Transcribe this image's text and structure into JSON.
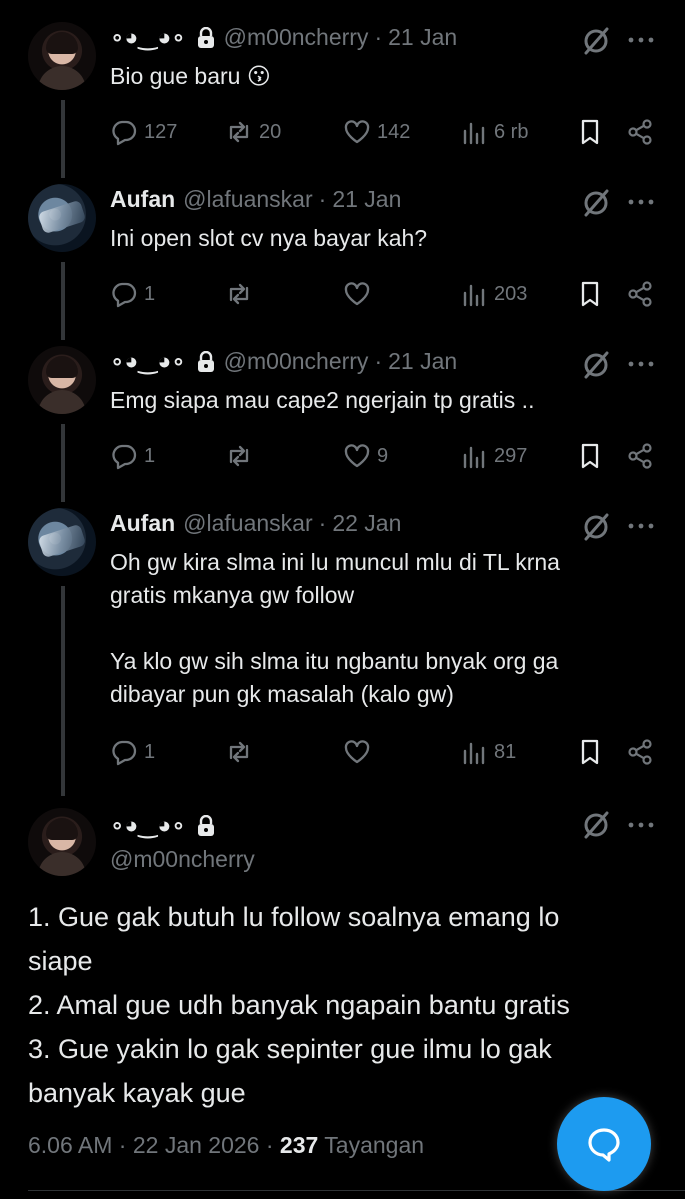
{
  "tweets": [
    {
      "name": "∘◕‿◕∘",
      "handle": "@m00ncherry",
      "date": "21 Jan",
      "text": "Bio gue baru 😗",
      "replies": "127",
      "retweets": "20",
      "likes": "142",
      "views": "6 rb",
      "protected": true,
      "avatar": "girl"
    },
    {
      "name": "Aufan",
      "handle": "@lafuanskar",
      "date": "21 Jan",
      "text": "Ini open slot cv nya bayar kah?",
      "replies": "1",
      "retweets": "",
      "likes": "",
      "views": "203",
      "protected": false,
      "avatar": "aufan"
    },
    {
      "name": "∘◕‿◕∘",
      "handle": "@m00ncherry",
      "date": "21 Jan",
      "text": "Emg siapa mau cape2 ngerjain tp gratis ..",
      "replies": "1",
      "retweets": "",
      "likes": "9",
      "views": "297",
      "protected": true,
      "avatar": "girl"
    },
    {
      "name": "Aufan",
      "handle": "@lafuanskar",
      "date": "22 Jan",
      "text": "Oh gw kira slma ini lu muncul mlu di TL krna\ngratis mkanya gw follow\n\nYa klo gw sih slma itu ngbantu bnyak org ga\ndibayar pun gk masalah (kalo gw)",
      "replies": "1",
      "retweets": "",
      "likes": "",
      "views": "81",
      "protected": false,
      "avatar": "aufan"
    }
  ],
  "main_tweet": {
    "name": "∘◕‿◕∘",
    "handle": "@m00ncherry",
    "text": "1. Gue gak butuh lu follow soalnya emang lo\nsiape\n2. Amal gue udh banyak ngapain bantu gratis\n3. Gue yakin lo gak sepinter gue ilmu lo gak\nbanyak kayak gue",
    "time": "6.06 AM",
    "date": "22 Jan 2026",
    "views_count": "237",
    "views_label": "Tayangan",
    "protected": true
  },
  "icons": {
    "reply": "reply-icon",
    "retweet": "retweet-icon",
    "like": "heart-icon",
    "views": "views-chart-icon",
    "bookmark": "bookmark-icon",
    "share": "share-icon",
    "grok": "grok-icon",
    "more": "more-dots-icon",
    "lock": "lock-icon",
    "fab": "compose-reply-icon"
  },
  "colors": {
    "background": "#000000",
    "text": "#e7e9ea",
    "muted": "#71767b",
    "accent": "#1d9bf0"
  }
}
